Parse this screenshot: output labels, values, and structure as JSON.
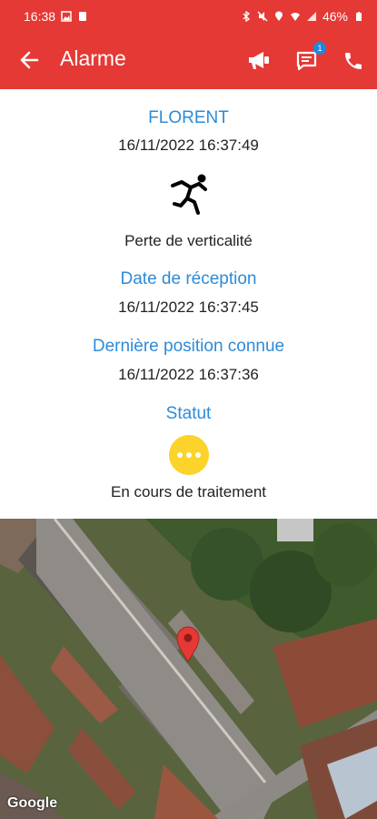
{
  "status_bar": {
    "time": "16:38",
    "battery": "46%"
  },
  "app_bar": {
    "title": "Alarme",
    "message_badge": "1"
  },
  "alarm": {
    "name": "FLORENT",
    "datetime": "16/11/2022 16:37:49",
    "type_label": "Perte de verticalité",
    "type_icon": "falling-person-icon",
    "reception_label": "Date de réception",
    "reception_value": "16/11/2022 16:37:45",
    "position_label": "Dernière position connue",
    "position_value": "16/11/2022 16:37:36",
    "status_label": "Statut",
    "status_value": "En cours de traitement",
    "status_color": "#fbd32a"
  },
  "map": {
    "attribution": "Google",
    "pin_color": "#e53935"
  },
  "colors": {
    "accent": "#e53935",
    "label_blue": "#2d8bd8"
  }
}
